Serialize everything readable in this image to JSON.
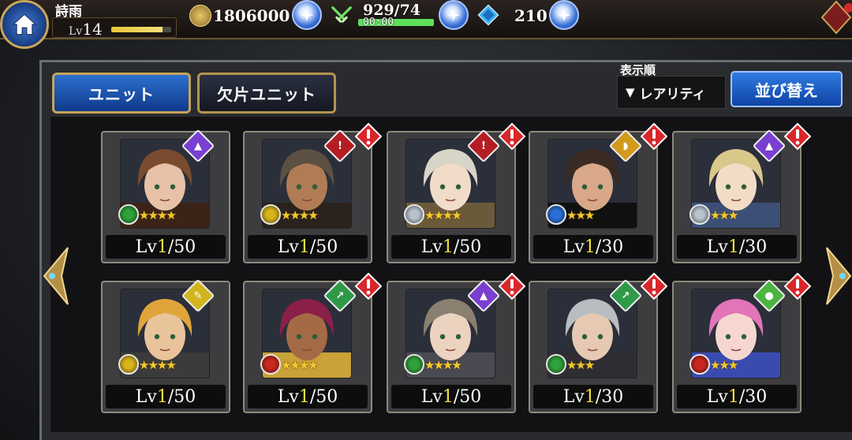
{
  "player": {
    "name": "詩雨",
    "level_label": "Lv",
    "level": "14",
    "exp_progress": 0.85
  },
  "resources": {
    "gold": "1806000",
    "stamina": "929/74",
    "stamina_timer": "00:00",
    "stamina_progress": 1.0,
    "gems": "210"
  },
  "tabs": [
    {
      "label": "ユニット",
      "active": true
    },
    {
      "label": "欠片ユニット",
      "active": false
    }
  ],
  "sort": {
    "caption": "表示順",
    "selected": "レアリティ",
    "button_label": "並び替え"
  },
  "units": [
    {
      "level_prefix": "Lv",
      "level_current": "1",
      "level_max": "/50",
      "stars": 4,
      "alert": false,
      "class_icon": "wizard-hat-icon",
      "class_color": "#7a3fd0",
      "element_color": "#2fa23a",
      "element_icon": "wind-element-icon",
      "palette": [
        "#7a4b2f",
        "#e7c2a8",
        "#3b2417"
      ]
    },
    {
      "level_prefix": "Lv",
      "level_current": "1",
      "level_max": "/50",
      "stars": 4,
      "alert": true,
      "class_icon": "sword-icon",
      "class_color": "#b41e22",
      "element_color": "#d8b31a",
      "element_icon": "thunder-element-icon",
      "palette": [
        "#5c5043",
        "#b17b55",
        "#2a221c"
      ]
    },
    {
      "level_prefix": "Lv",
      "level_current": "1",
      "level_max": "/50",
      "stars": 4,
      "alert": true,
      "class_icon": "sword-icon",
      "class_color": "#b41e22",
      "element_color": "#b8c2cc",
      "element_icon": "light-element-icon",
      "palette": [
        "#d9d4c8",
        "#f0dcc8",
        "#6b5a3a"
      ]
    },
    {
      "level_prefix": "Lv",
      "level_current": "1",
      "level_max": "/30",
      "stars": 3,
      "alert": true,
      "class_icon": "bow-icon",
      "class_color": "#d29a1d",
      "element_color": "#2a6fd6",
      "element_icon": "water-element-icon",
      "palette": [
        "#3a2a22",
        "#d9a888",
        "#111111"
      ]
    },
    {
      "level_prefix": "Lv",
      "level_current": "1",
      "level_max": "/30",
      "stars": 3,
      "alert": true,
      "class_icon": "wizard-hat-icon",
      "class_color": "#7a3fd0",
      "element_color": "#b8c2cc",
      "element_icon": "light-element-icon",
      "palette": [
        "#d9c88a",
        "#f3dcc6",
        "#3c4f77"
      ]
    },
    {
      "level_prefix": "Lv",
      "level_current": "1",
      "level_max": "/50",
      "stars": 4,
      "alert": false,
      "class_icon": "tool-icon",
      "class_color": "#d2b51d",
      "element_color": "#d8b31a",
      "element_icon": "thunder-element-icon",
      "palette": [
        "#e0a53a",
        "#e9c39a",
        "#3b3b3b"
      ]
    },
    {
      "level_prefix": "Lv",
      "level_current": "1",
      "level_max": "/50",
      "stars": 4,
      "alert": true,
      "class_icon": "spear-icon",
      "class_color": "#2e9a47",
      "element_color": "#c9281f",
      "element_icon": "fire-element-icon",
      "palette": [
        "#8a1f48",
        "#a46a45",
        "#c9a238"
      ]
    },
    {
      "level_prefix": "Lv",
      "level_current": "1",
      "level_max": "/50",
      "stars": 4,
      "alert": true,
      "class_icon": "wizard-hat-icon",
      "class_color": "#7a3fd0",
      "element_color": "#2fa23a",
      "element_icon": "wind-element-icon",
      "palette": [
        "#8a8070",
        "#ecd3c0",
        "#4a4a52"
      ]
    },
    {
      "level_prefix": "Lv",
      "level_current": "1",
      "level_max": "/30",
      "stars": 3,
      "alert": true,
      "class_icon": "spear-icon",
      "class_color": "#2e9a47",
      "element_color": "#2fa23a",
      "element_icon": "wind-element-icon",
      "palette": [
        "#b9bdc2",
        "#e6c9b2",
        "#2d2d33"
      ]
    },
    {
      "level_prefix": "Lv",
      "level_current": "1",
      "level_max": "/30",
      "stars": 3,
      "alert": true,
      "class_icon": "potion-icon",
      "class_color": "#4bb540",
      "element_color": "#c9281f",
      "element_icon": "fire-element-icon",
      "palette": [
        "#e274b8",
        "#f6d7d0",
        "#3a4bb0"
      ]
    }
  ]
}
